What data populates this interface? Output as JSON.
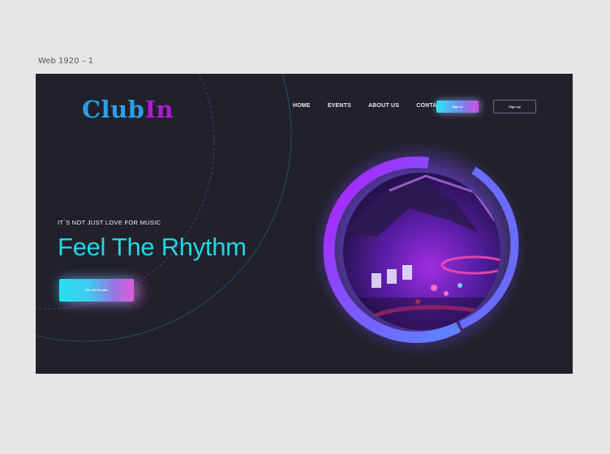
{
  "canvas": {
    "frame_label": "Web 1920 – 1"
  },
  "brand": {
    "part1": "Club",
    "part2": "In",
    "color1": "#2aa0e6",
    "color2": "#b11ad6"
  },
  "nav": {
    "items": [
      {
        "label": "HOME"
      },
      {
        "label": "EVENTS"
      },
      {
        "label": "ABOUT US"
      },
      {
        "label": "CONTACT"
      }
    ],
    "signin_label": "Sign in",
    "signup_label": "Sign up"
  },
  "hero": {
    "tagline": "IT`S NOT JUST LOVE FOR MUSIC",
    "headline": "Feel The Rhythm",
    "cta_label": "See All Events",
    "image_subject": "dj-turntable-photo"
  },
  "colors": {
    "background": "#21212b",
    "accent_cyan": "#22d6e3",
    "accent_purple": "#b11ad6",
    "accent_pink": "#e45ad8",
    "ring_blue": "#5b74ff"
  }
}
